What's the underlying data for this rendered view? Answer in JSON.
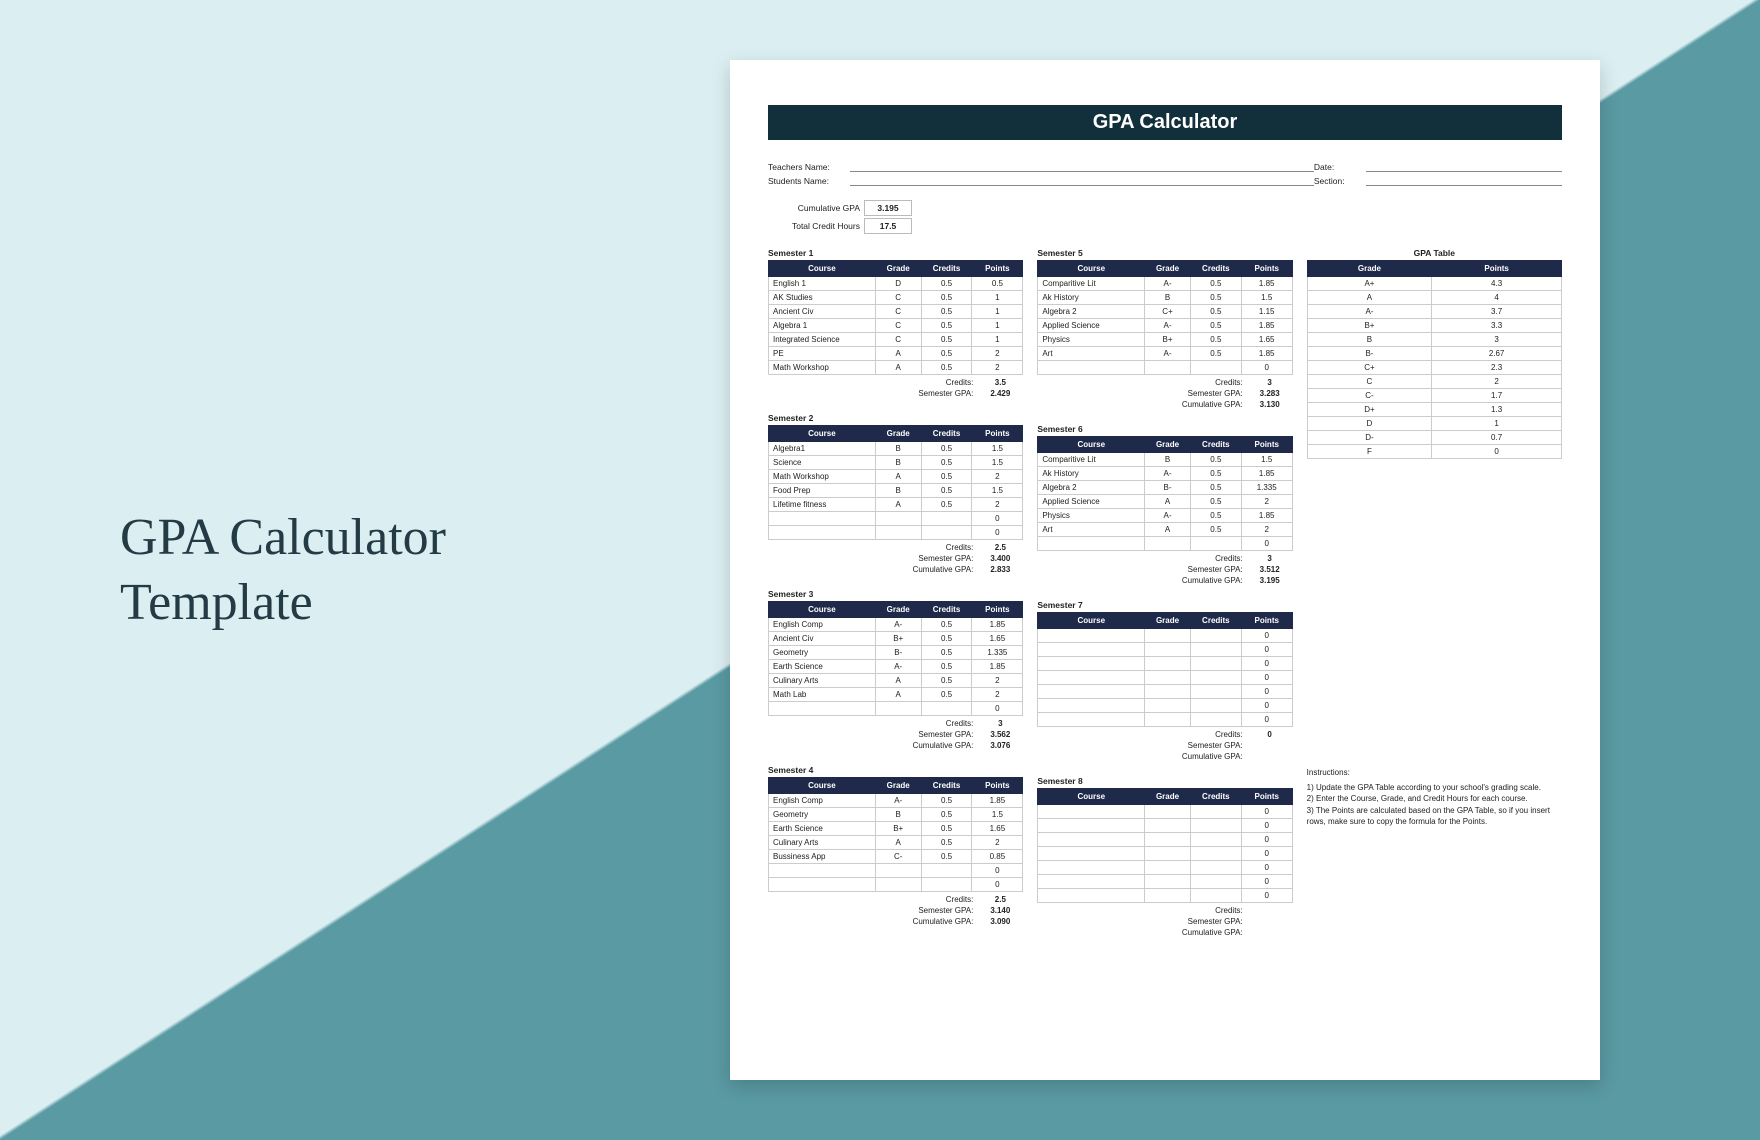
{
  "leftTitle": "GPA Calculator\nTemplate",
  "header": "GPA Calculator",
  "meta": {
    "teacher_label": "Teachers Name:",
    "student_label": "Students Name:",
    "date_label": "Date:",
    "section_label": "Section:"
  },
  "summary": {
    "cum_label": "Cumulative GPA",
    "cum_val": "3.195",
    "hours_label": "Total Credit Hours",
    "hours_val": "17.5"
  },
  "cols": {
    "course": "Course",
    "grade": "Grade",
    "credits": "Credits",
    "points": "Points"
  },
  "tot_labels": {
    "credits": "Credits:",
    "sem_gpa": "Semester GPA:",
    "cum_gpa": "Cumulative GPA:"
  },
  "semesters": [
    {
      "title": "Semester 1",
      "rows": [
        [
          "English 1",
          "D",
          "0.5",
          "0.5"
        ],
        [
          "AK Studies",
          "C",
          "0.5",
          "1"
        ],
        [
          "Ancient Civ",
          "C",
          "0.5",
          "1"
        ],
        [
          "Algebra 1",
          "C",
          "0.5",
          "1"
        ],
        [
          "Integrated Science",
          "C",
          "0.5",
          "1"
        ],
        [
          "PE",
          "A",
          "0.5",
          "2"
        ],
        [
          "Math Workshop",
          "A",
          "0.5",
          "2"
        ]
      ],
      "credits": "3.5",
      "sem_gpa": "2.429",
      "cum_gpa": null
    },
    {
      "title": "Semester 2",
      "rows": [
        [
          "Algebra1",
          "B",
          "0.5",
          "1.5"
        ],
        [
          "Science",
          "B",
          "0.5",
          "1.5"
        ],
        [
          "Math Workshop",
          "A",
          "0.5",
          "2"
        ],
        [
          "Food Prep",
          "B",
          "0.5",
          "1.5"
        ],
        [
          "Lifetime fitness",
          "A",
          "0.5",
          "2"
        ],
        [
          "",
          "",
          "",
          "0"
        ],
        [
          "",
          "",
          "",
          "0"
        ]
      ],
      "credits": "2.5",
      "sem_gpa": "3.400",
      "cum_gpa": "2.833"
    },
    {
      "title": "Semester 3",
      "rows": [
        [
          "English Comp",
          "A-",
          "0.5",
          "1.85"
        ],
        [
          "Ancient Civ",
          "B+",
          "0.5",
          "1.65"
        ],
        [
          "Geometry",
          "B-",
          "0.5",
          "1.335"
        ],
        [
          "Earth Science",
          "A-",
          "0.5",
          "1.85"
        ],
        [
          "Culinary Arts",
          "A",
          "0.5",
          "2"
        ],
        [
          "Math Lab",
          "A",
          "0.5",
          "2"
        ],
        [
          "",
          "",
          "",
          "0"
        ]
      ],
      "credits": "3",
      "sem_gpa": "3.562",
      "cum_gpa": "3.076"
    },
    {
      "title": "Semester 4",
      "rows": [
        [
          "English Comp",
          "A-",
          "0.5",
          "1.85"
        ],
        [
          "Geometry",
          "B",
          "0.5",
          "1.5"
        ],
        [
          "Earth Science",
          "B+",
          "0.5",
          "1.65"
        ],
        [
          "Culinary Arts",
          "A",
          "0.5",
          "2"
        ],
        [
          "Bussiness App",
          "C-",
          "0.5",
          "0.85"
        ],
        [
          "",
          "",
          "",
          "0"
        ],
        [
          "",
          "",
          "",
          "0"
        ]
      ],
      "credits": "2.5",
      "sem_gpa": "3.140",
      "cum_gpa": "3.090"
    },
    {
      "title": "Semester 5",
      "rows": [
        [
          "Comparitive Lit",
          "A-",
          "0.5",
          "1.85"
        ],
        [
          "Ak History",
          "B",
          "0.5",
          "1.5"
        ],
        [
          "Algebra 2",
          "C+",
          "0.5",
          "1.15"
        ],
        [
          "Applied Science",
          "A-",
          "0.5",
          "1.85"
        ],
        [
          "Physics",
          "B+",
          "0.5",
          "1.65"
        ],
        [
          "Art",
          "A-",
          "0.5",
          "1.85"
        ],
        [
          "",
          "",
          "",
          "0"
        ]
      ],
      "credits": "3",
      "sem_gpa": "3.283",
      "cum_gpa": "3.130"
    },
    {
      "title": "Semester 6",
      "rows": [
        [
          "Comparitive Lit",
          "B",
          "0.5",
          "1.5"
        ],
        [
          "Ak History",
          "A-",
          "0.5",
          "1.85"
        ],
        [
          "Algebra 2",
          "B-",
          "0.5",
          "1.335"
        ],
        [
          "Applied Science",
          "A",
          "0.5",
          "2"
        ],
        [
          "Physics",
          "A-",
          "0.5",
          "1.85"
        ],
        [
          "Art",
          "A",
          "0.5",
          "2"
        ],
        [
          "",
          "",
          "",
          "0"
        ]
      ],
      "credits": "3",
      "sem_gpa": "3.512",
      "cum_gpa": "3.195"
    },
    {
      "title": "Semester 7",
      "rows": [
        [
          "",
          "",
          "",
          "0"
        ],
        [
          "",
          "",
          "",
          "0"
        ],
        [
          "",
          "",
          "",
          "0"
        ],
        [
          "",
          "",
          "",
          "0"
        ],
        [
          "",
          "",
          "",
          "0"
        ],
        [
          "",
          "",
          "",
          "0"
        ],
        [
          "",
          "",
          "",
          "0"
        ]
      ],
      "credits": "0",
      "sem_gpa": "",
      "cum_gpa": ""
    },
    {
      "title": "Semester 8",
      "rows": [
        [
          "",
          "",
          "",
          "0"
        ],
        [
          "",
          "",
          "",
          "0"
        ],
        [
          "",
          "",
          "",
          "0"
        ],
        [
          "",
          "",
          "",
          "0"
        ],
        [
          "",
          "",
          "",
          "0"
        ],
        [
          "",
          "",
          "",
          "0"
        ],
        [
          "",
          "",
          "",
          "0"
        ]
      ],
      "credits": "",
      "sem_gpa": "",
      "cum_gpa": ""
    }
  ],
  "gpa_table": {
    "title": "GPA Table",
    "head": [
      "Grade",
      "Points"
    ],
    "rows": [
      [
        "A+",
        "4.3"
      ],
      [
        "A",
        "4"
      ],
      [
        "A-",
        "3.7"
      ],
      [
        "B+",
        "3.3"
      ],
      [
        "B",
        "3"
      ],
      [
        "B-",
        "2.67"
      ],
      [
        "C+",
        "2.3"
      ],
      [
        "C",
        "2"
      ],
      [
        "C-",
        "1.7"
      ],
      [
        "D+",
        "1.3"
      ],
      [
        "D",
        "1"
      ],
      [
        "D-",
        "0.7"
      ],
      [
        "F",
        "0"
      ]
    ]
  },
  "instructions": {
    "head": "Instructions:",
    "items": [
      "1) Update the GPA Table according to your school's grading scale.",
      "2) Enter the Course, Grade, and Credit Hours for each course.",
      "3) The Points are calculated based on the GPA Table, so if you insert rows, make sure to copy the formula for the Points."
    ]
  }
}
